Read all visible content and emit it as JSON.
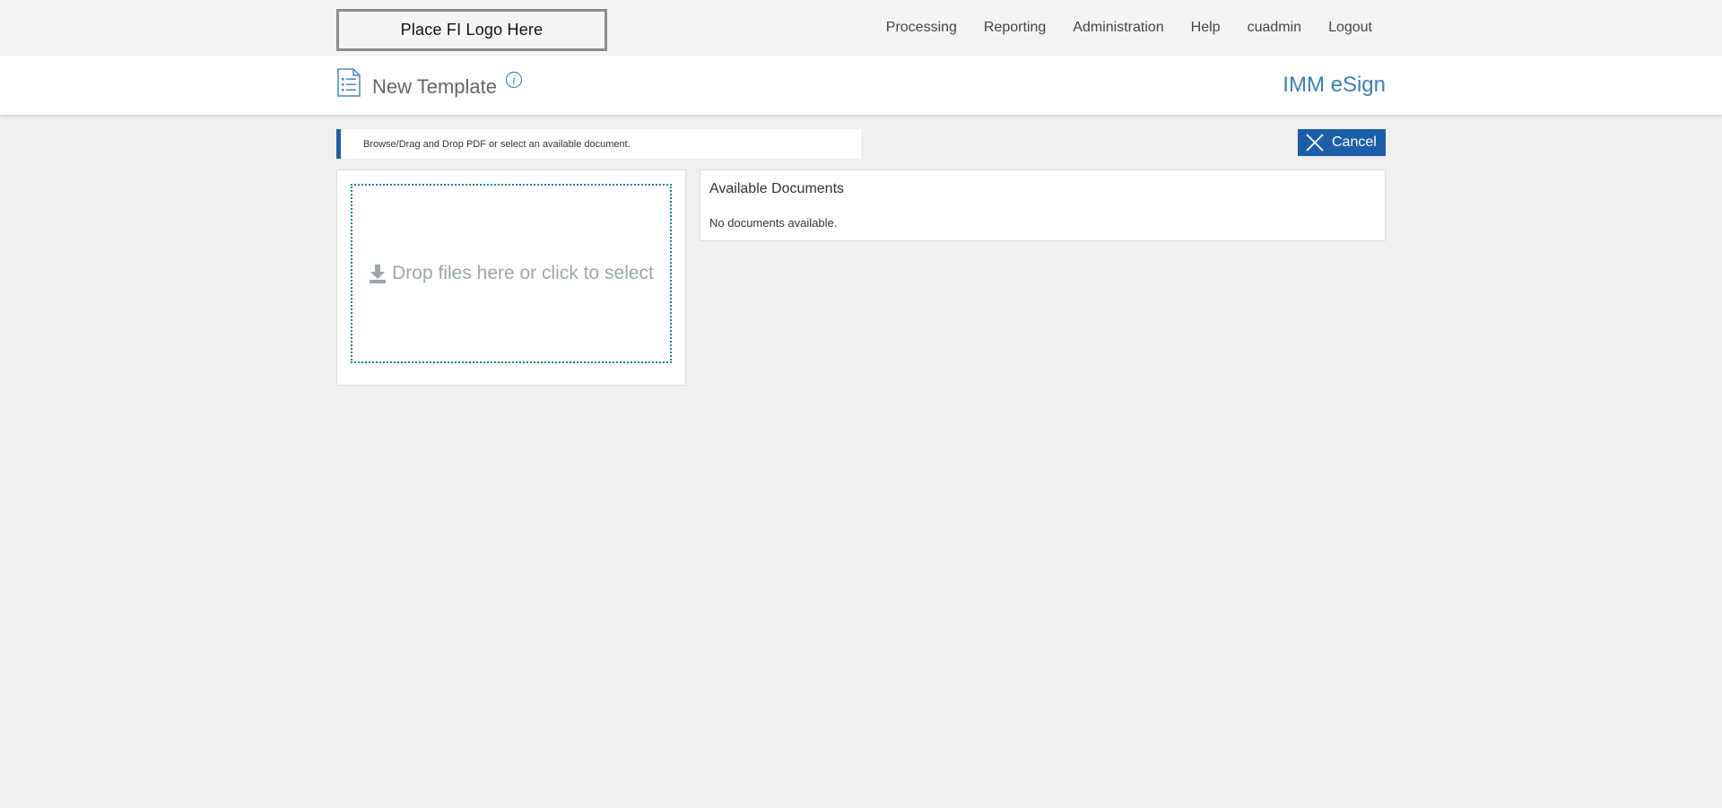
{
  "header": {
    "logo_text": "Place FI Logo Here",
    "nav": [
      "Processing",
      "Reporting",
      "Administration",
      "Help",
      "cuadmin",
      "Logout"
    ]
  },
  "titlebar": {
    "title": "New Template",
    "brand": "IMM eSign",
    "title_icon": "list-document-icon",
    "info_icon": "info-icon"
  },
  "toolbar": {
    "instruction": "Browse/Drag and Drop PDF or select an available document.",
    "cancel_label": "Cancel",
    "cancel_icon": "close-icon"
  },
  "upload": {
    "dropzone_text": "Drop files here or click to select",
    "icon": "download-icon"
  },
  "documents": {
    "title": "Available Documents",
    "empty_text": "No documents available."
  },
  "colors": {
    "accent": "#1d5ea8",
    "brand": "#3d7eb9",
    "dropzone_border": "#17878a",
    "dropzone_text": "#9aa7ad"
  }
}
